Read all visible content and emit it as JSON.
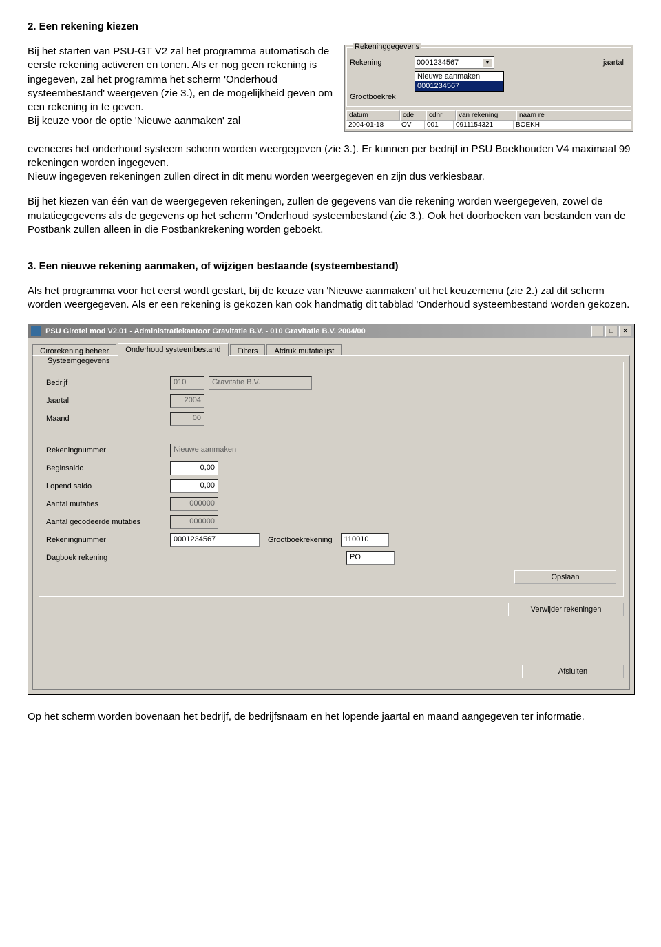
{
  "section2": {
    "heading": "2. Een rekening kiezen",
    "p1": "Bij het starten van PSU-GT V2 zal het programma automatisch de eerste rekening activeren en tonen. Als er nog geen rekening is ingegeven, zal het programma het scherm 'Onderhoud systeembestand' weergeven (zie 3.), en de mogelijkheid geven om een rekening in te geven.",
    "p1b": "Bij keuze voor de optie 'Nieuwe aanmaken' zal",
    "p2": "eveneens het onderhoud systeem scherm worden weergegeven (zie 3.). Er kunnen per bedrijf in PSU Boekhouden V4 maximaal 99 rekeningen worden ingegeven.",
    "p3": "Nieuw ingegeven rekeningen zullen direct in dit menu worden weergegeven en zijn dus verkiesbaar.",
    "p4": "Bij het kiezen van één van de weergegeven rekeningen, zullen de gegevens van die rekening worden weergegeven, zowel de mutatiegegevens als de gegevens op het scherm 'Onderhoud systeembestand (zie 3.). Ook het doorboeken van bestanden van de Postbank zullen alleen in die Postbankrekening worden geboekt."
  },
  "mini": {
    "group": "Rekeninggegevens",
    "label_rekening": "Rekening",
    "label_jaartal": "jaartal",
    "label_grootboekrek": "Grootboekrek",
    "select_value": "0001234567",
    "dd_option1": "Nieuwe aanmaken",
    "dd_option2": "0001234567",
    "th_datum": "datum",
    "th_cde": "cde",
    "th_cdnr": "cdnr",
    "th_van": "van rekening",
    "th_naam": "naam re",
    "tr_datum": "2004-01-18",
    "tr_cde": "OV",
    "tr_cdnr": "001",
    "tr_van": "0911154321",
    "tr_naam": "BOEKH"
  },
  "section3": {
    "heading": "3. Een nieuwe rekening aanmaken, of wijzigen bestaande (systeembestand)",
    "p1": "Als het programma voor het eerst wordt gestart, bij de keuze van 'Nieuwe aanmaken' uit het keuzemenu (zie 2.) zal dit scherm worden weergegeven. Als er een rekening is gekozen kan ook handmatig dit tabblad 'Onderhoud systeembestand worden gekozen."
  },
  "app": {
    "title": "PSU Girotel mod V2.01 - Administratiekantoor Gravitatie B.V.          - 010  Gravitatie B.V.                    2004/00",
    "tabs": {
      "t1": "Girorekening beheer",
      "t2": "Onderhoud systeembestand",
      "t3": "Filters",
      "t4": "Afdruk mutatielijst"
    },
    "group": "Systeemgegevens",
    "labels": {
      "bedrijf": "Bedrijf",
      "jaartal": "Jaartal",
      "maand": "Maand",
      "rekeningnummer": "Rekeningnummer",
      "beginsaldo": "Beginsaldo",
      "lopend_saldo": "Lopend saldo",
      "aantal_mutaties": "Aantal mutaties",
      "aantal_gecodeerde": "Aantal gecodeerde mutaties",
      "rekeningnummer2": "Rekeningnummer",
      "grootboekrekening": "Grootboekrekening",
      "dagboek": "Dagboek rekening"
    },
    "values": {
      "bedrijf_code": "010",
      "bedrijf_naam": "Gravitatie B.V.",
      "jaartal": "2004",
      "maand": "00",
      "rekeningnummer": "Nieuwe aanmaken",
      "beginsaldo": "0,00",
      "lopend_saldo": "0,00",
      "aantal_mutaties": "000000",
      "aantal_gecodeerde": "000000",
      "rekeningnummer2": "0001234567",
      "grootboekrekening": "110010",
      "dagboek": "PO"
    },
    "buttons": {
      "opslaan": "Opslaan",
      "verwijder": "Verwijder rekeningen",
      "afsluiten": "Afsluiten"
    }
  },
  "footer": "Op het scherm worden bovenaan het bedrijf, de bedrijfsnaam en het lopende jaartal en maand aangegeven ter informatie."
}
